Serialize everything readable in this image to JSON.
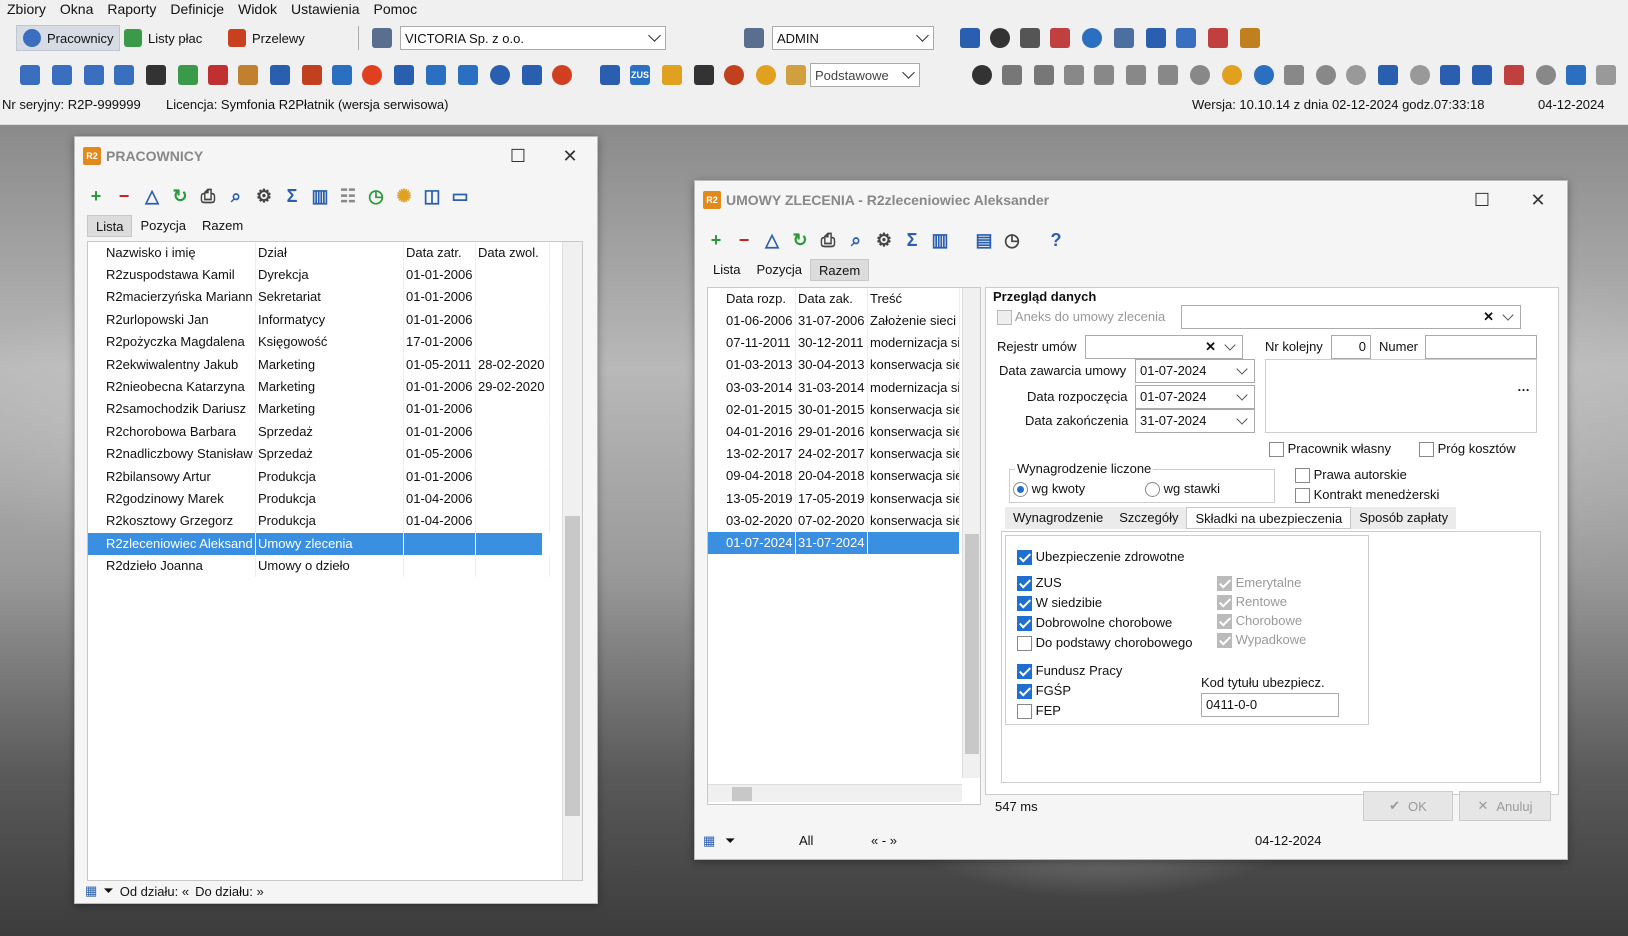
{
  "menu": [
    "Zbiory",
    "Okna",
    "Raporty",
    "Definicje",
    "Widok",
    "Ustawienia",
    "Pomoc"
  ],
  "toolbar": {
    "pracownicy": "Pracownicy",
    "listy_plac": "Listy płac",
    "przelewy": "Przelewy",
    "firm": "VICTORIA Sp. z o.o.",
    "user": "ADMIN",
    "view_mode": "Podstawowe"
  },
  "status": {
    "serial": "Nr seryjny: R2P-999999",
    "license": "Licencja: Symfonia R2Płatnik (wersja serwisowa)",
    "version": "Wersja: 10.10.14 z dnia 02-12-2024 godz.07:33:18",
    "date": "04-12-2024"
  },
  "pracownicy": {
    "title": "PRACOWNICY",
    "tabs": [
      "Lista",
      "Pozycja",
      "Razem"
    ],
    "columns": [
      "Nazwisko i imię",
      "Dział",
      "Data zatr.",
      "Data zwol."
    ],
    "rows": [
      [
        "R2zuspodstawa Kamil",
        "Dyrekcja",
        "01-01-2006",
        ""
      ],
      [
        "R2macierzyńska Mariann",
        "Sekretariat",
        "01-01-2006",
        ""
      ],
      [
        "R2urlopowski Jan",
        "Informatycy",
        "01-01-2006",
        ""
      ],
      [
        "R2pożyczka Magdalena",
        "Księgowość",
        "17-01-2006",
        ""
      ],
      [
        "R2ekwiwalentny Jakub",
        "Marketing",
        "01-05-2011",
        "28-02-2020"
      ],
      [
        "R2nieobecna Katarzyna",
        "Marketing",
        "01-01-2006",
        "29-02-2020"
      ],
      [
        "R2samochodzik Dariusz",
        "Marketing",
        "01-01-2006",
        ""
      ],
      [
        "R2chorobowa Barbara",
        "Sprzedaż",
        "01-01-2006",
        ""
      ],
      [
        "R2nadliczbowy Stanisław",
        "Sprzedaż",
        "01-05-2006",
        ""
      ],
      [
        "R2bilansowy Artur",
        "Produkcja",
        "01-01-2006",
        ""
      ],
      [
        "R2godzinowy Marek",
        "Produkcja",
        "01-04-2006",
        ""
      ],
      [
        "R2kosztowy Grzegorz",
        "Produkcja",
        "01-04-2006",
        ""
      ],
      [
        "R2zleceniowiec Aleksand",
        "Umowy zlecenia",
        "",
        ""
      ],
      [
        "R2dzieło Joanna",
        "Umowy o dzieło",
        "",
        ""
      ]
    ],
    "footer_from": "Od działu: «",
    "footer_to": "Do działu: »"
  },
  "umowy": {
    "title": "UMOWY ZLECENIA - R2zleceniowiec Aleksander",
    "tabs": [
      "Lista",
      "Pozycja",
      "Razem"
    ],
    "columns": [
      "Data rozp.",
      "Data zak.",
      "Treść"
    ],
    "rows": [
      [
        "01-06-2006",
        "31-07-2006",
        "Założenie sieci"
      ],
      [
        "07-11-2011",
        "30-12-2011",
        "modernizacja si"
      ],
      [
        "01-03-2013",
        "30-04-2013",
        "konserwacja sie"
      ],
      [
        "03-03-2014",
        "31-03-2014",
        "modernizacja si"
      ],
      [
        "02-01-2015",
        "30-01-2015",
        "konserwacja sie"
      ],
      [
        "04-01-2016",
        "29-01-2016",
        "konserwacja sie"
      ],
      [
        "13-02-2017",
        "24-02-2017",
        "konserwacja sie"
      ],
      [
        "09-04-2018",
        "20-04-2018",
        "konserwacja sie"
      ],
      [
        "13-05-2019",
        "17-05-2019",
        "konserwacja sie"
      ],
      [
        "03-02-2020",
        "07-02-2020",
        "konserwacja sie"
      ],
      [
        "01-07-2024",
        "31-07-2024",
        ""
      ]
    ],
    "form": {
      "heading": "Przegląd danych",
      "aneks": "Aneks do umowy zlecenia",
      "rejestr_label": "Rejestr umów",
      "nr_kolejny_label": "Nr kolejny",
      "nr_kolejny": "0",
      "numer_label": "Numer",
      "data_zawarcia_label": "Data zawarcia umowy",
      "data_zawarcia": "01-07-2024",
      "data_rozp_label": "Data rozpoczęcia",
      "data_rozp": "01-07-2024",
      "data_zak_label": "Data zakończenia",
      "data_zak": "31-07-2024",
      "pracownik_wlasny": "Pracownik własny",
      "prog_kosztow": "Próg kosztów",
      "wynagrodzenie_group": "Wynagrodzenie liczone",
      "wg_kwoty": "wg kwoty",
      "wg_stawki": "wg stawki",
      "prawa_autorskie": "Prawa autorskie",
      "kontrakt": "Kontrakt menedżerski",
      "subtabs": [
        "Wynagrodzenie",
        "Szczegóły",
        "Składki na ubezpieczenia",
        "Sposób zapłaty"
      ],
      "ubezp_zdrowotne": "Ubezpieczenie zdrowotne",
      "zus": "ZUS",
      "w_siedzibie": "W siedzibie",
      "dobrowolne": "Dobrowolne chorobowe",
      "do_podstawy": "Do podstawy chorobowego",
      "emerytalne": "Emerytalne",
      "rentowe": "Rentowe",
      "chorobowe": "Chorobowe",
      "wypadkowe": "Wypadkowe",
      "fundusz_pracy": "Fundusz Pracy",
      "fgsp": "FGŚP",
      "fep": "FEP",
      "kod_label": "Kod tytułu ubezpiecz.",
      "kod": "0411-0-0"
    },
    "timing": "547 ms",
    "ok": "OK",
    "anuluj": "Anuluj",
    "footer_all": "All",
    "footer_nav": "« - »",
    "footer_date": "04-12-2024"
  }
}
